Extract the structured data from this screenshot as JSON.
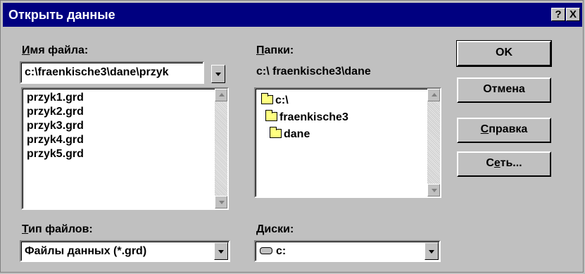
{
  "window": {
    "title": "Открыть данные",
    "help_button": "?",
    "close_button": "X"
  },
  "file_name": {
    "label_underlined": "И",
    "label_rest": "мя файла:",
    "value": "c:\\fraenkische3\\dane\\przyk",
    "files": [
      "przyk1.grd",
      "przyk2.grd",
      "przyk3.grd",
      "przyk4.grd",
      "przyk5.grd"
    ]
  },
  "folders": {
    "label_underlined": "П",
    "label_rest": "апки:",
    "current_path": "c:\\ fraenkische3\\dane",
    "tree": [
      "c:\\",
      "fraenkische3",
      "dane"
    ]
  },
  "file_type": {
    "label_underlined": "Т",
    "label_rest": "ип файлов:",
    "value": "Файлы данных (*.grd)"
  },
  "drives": {
    "label_underlined": "Д",
    "label_rest": "иски:",
    "value": "c:"
  },
  "buttons": {
    "ok": "OK",
    "cancel": "Отмена",
    "help_underlined": "С",
    "help_rest": "правка",
    "network_pre": "С",
    "network_underlined": "е",
    "network_rest": "ть..."
  },
  "icons": {
    "folder": "folder-icon",
    "drive": "hard-drive-icon",
    "combo": "chevron-down-icon",
    "scroll_up": "scroll-up-arrow-icon",
    "scroll_down": "scroll-down-arrow-icon"
  },
  "colors": {
    "title_bar": "#000080",
    "face": "#c0c0c0",
    "field": "#ffffff"
  }
}
